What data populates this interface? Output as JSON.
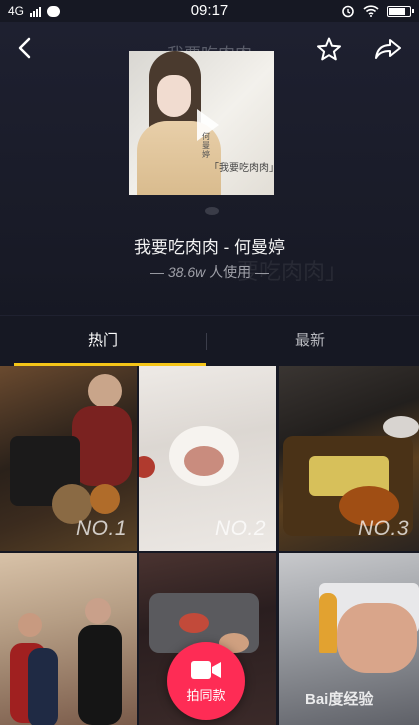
{
  "status_bar": {
    "network": "4G",
    "time": "09:17"
  },
  "nav": {
    "title": "我要吃肉肉"
  },
  "cover": {
    "vertical_text": "何曼婷",
    "stamp": "「我要吃肉肉」"
  },
  "music": {
    "song": "我要吃肉肉 - 何曼婷",
    "users_count": "38.6w",
    "users_suffix": "人使用",
    "users_prefix_dash": "—",
    "users_suffix_dash": "—",
    "ghost_text": "要吃肉肉」"
  },
  "tabs": [
    {
      "label": "热门"
    },
    {
      "label": "最新"
    }
  ],
  "videos": [
    {
      "rank": "NO.1"
    },
    {
      "rank": "NO.2"
    },
    {
      "rank": "NO.3"
    },
    {
      "rank": ""
    },
    {
      "rank": ""
    },
    {
      "rank": ""
    }
  ],
  "record_button": {
    "label": "拍同款"
  },
  "watermark": "Bai度经验",
  "colors": {
    "background": "#161823",
    "accent_tab_indicator": "#f5c518",
    "record_button": "#fe2c55"
  }
}
